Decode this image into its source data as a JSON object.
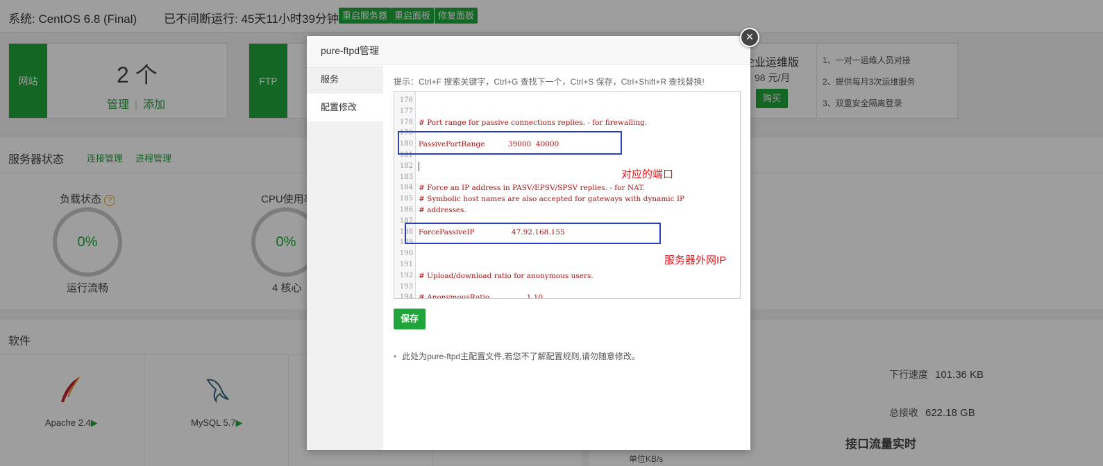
{
  "topbar": {
    "system": "系统: CentOS 6.8 (Final)",
    "uptime": "已不间断运行: 45天11小时39分钟",
    "buttons": [
      "重启服务器",
      "重启面板",
      "修复面板"
    ]
  },
  "site_card": {
    "tag": "网站",
    "count": "2 个",
    "manage": "管理",
    "separator": "|",
    "add": "添加"
  },
  "ftp_card": {
    "tag": "FTP"
  },
  "promo": {
    "title": "企业运维版",
    "price": "98 元/月",
    "buy": "购买",
    "features": [
      "1、一对一运维人员对接",
      "2、提供每月3次运维服务",
      "3、双重安全隔离登录"
    ]
  },
  "server_status": {
    "title": "服务器状态",
    "links": [
      "连接管理",
      "进程管理"
    ],
    "load": {
      "label": "负载状态",
      "help": "?",
      "value": "0%",
      "sub": "运行流畅"
    },
    "cpu": {
      "label": "CPU使用率",
      "value": "0%",
      "sub": "4 核心"
    }
  },
  "software": {
    "title": "软件",
    "items": [
      {
        "name": "Apache 2.4",
        "arrow": "▶"
      },
      {
        "name": "MySQL 5.7",
        "arrow": "▶"
      }
    ]
  },
  "traffic": {
    "down_label": "下行速度",
    "down_value": "101.36 KB",
    "total_label": "总接收",
    "total_value": "622.18 GB",
    "title": "接口流量实时",
    "unit": "单位KB/s"
  },
  "modal": {
    "title": "pure-ftpd管理",
    "close": "×",
    "tabs": [
      "服务",
      "配置修改"
    ],
    "active_tab": 1,
    "hint": "提示：Ctrl+F 搜索关键字，Ctrl+G 查找下一个，Ctrl+S 保存，Ctrl+Shift+R 查找替换!",
    "lines": [
      {
        "n": "176",
        "code": ""
      },
      {
        "n": "177",
        "code": ""
      },
      {
        "n": "178",
        "code": "# Port range for passive connections replies. - for firewalling."
      },
      {
        "n": "179",
        "code": ""
      },
      {
        "n": "180",
        "code": "PassivePortRange          39000  40000"
      },
      {
        "n": "181",
        "code": ""
      },
      {
        "n": "182",
        "code": ""
      },
      {
        "n": "183",
        "code": ""
      },
      {
        "n": "184",
        "code": "# Force an IP address in PASV/EPSV/SPSV replies. - for NAT."
      },
      {
        "n": "185",
        "code": "# Symbolic host names are also accepted for gateways with dynamic IP"
      },
      {
        "n": "186",
        "code": "# addresses."
      },
      {
        "n": "187",
        "code": ""
      },
      {
        "n": "188",
        "code": "ForcePassiveIP                47.92.168.155"
      },
      {
        "n": "189",
        "code": ""
      },
      {
        "n": "190",
        "code": ""
      },
      {
        "n": "191",
        "code": ""
      },
      {
        "n": "192",
        "code": "# Upload/download ratio for anonymous users."
      },
      {
        "n": "193",
        "code": ""
      },
      {
        "n": "194",
        "code": "# AnonymousRatio                1 10"
      }
    ],
    "annotations": [
      "对应的端口",
      "服务器外网IP"
    ],
    "save": "保存",
    "note": "此处为pure-ftpd主配置文件,若您不了解配置规则,请勿随意修改。"
  }
}
